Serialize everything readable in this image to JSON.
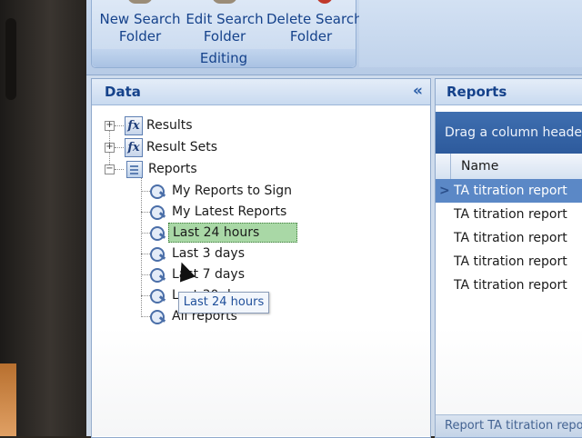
{
  "ribbon": {
    "buttons": [
      {
        "line1": "New Search",
        "line2": "Folder"
      },
      {
        "line1": "Edit Search",
        "line2": "Folder"
      },
      {
        "line1": "Delete Search",
        "line2": "Folder"
      }
    ],
    "group_label": "Editing"
  },
  "data_pane": {
    "title": "Data",
    "collapse_glyph": "«",
    "tree": {
      "results": "Results",
      "result_sets": "Result Sets",
      "reports": "Reports",
      "children": [
        "My Reports to Sign",
        "My Latest Reports",
        "Last 24 hours",
        "Last 3 days",
        "Last 7 days",
        "Last 30 days",
        "All reports"
      ]
    },
    "tooltip": "Last 24 hours",
    "expander_plus": "+",
    "expander_minus": "−",
    "fx_glyph": "fx"
  },
  "reports_pane": {
    "title": "Reports",
    "group_hint": "Drag a column header h",
    "column_name": "Name",
    "current_row_marker": ">",
    "rows": [
      "TA titration report",
      "TA titration report",
      "TA titration report",
      "TA titration report",
      "TA titration report"
    ],
    "footer": "Report TA titration repo"
  },
  "colors": {
    "ribbon_text": "#15428b",
    "selection_green": "#a9d8a6",
    "row_selected": "#5b88c6"
  }
}
